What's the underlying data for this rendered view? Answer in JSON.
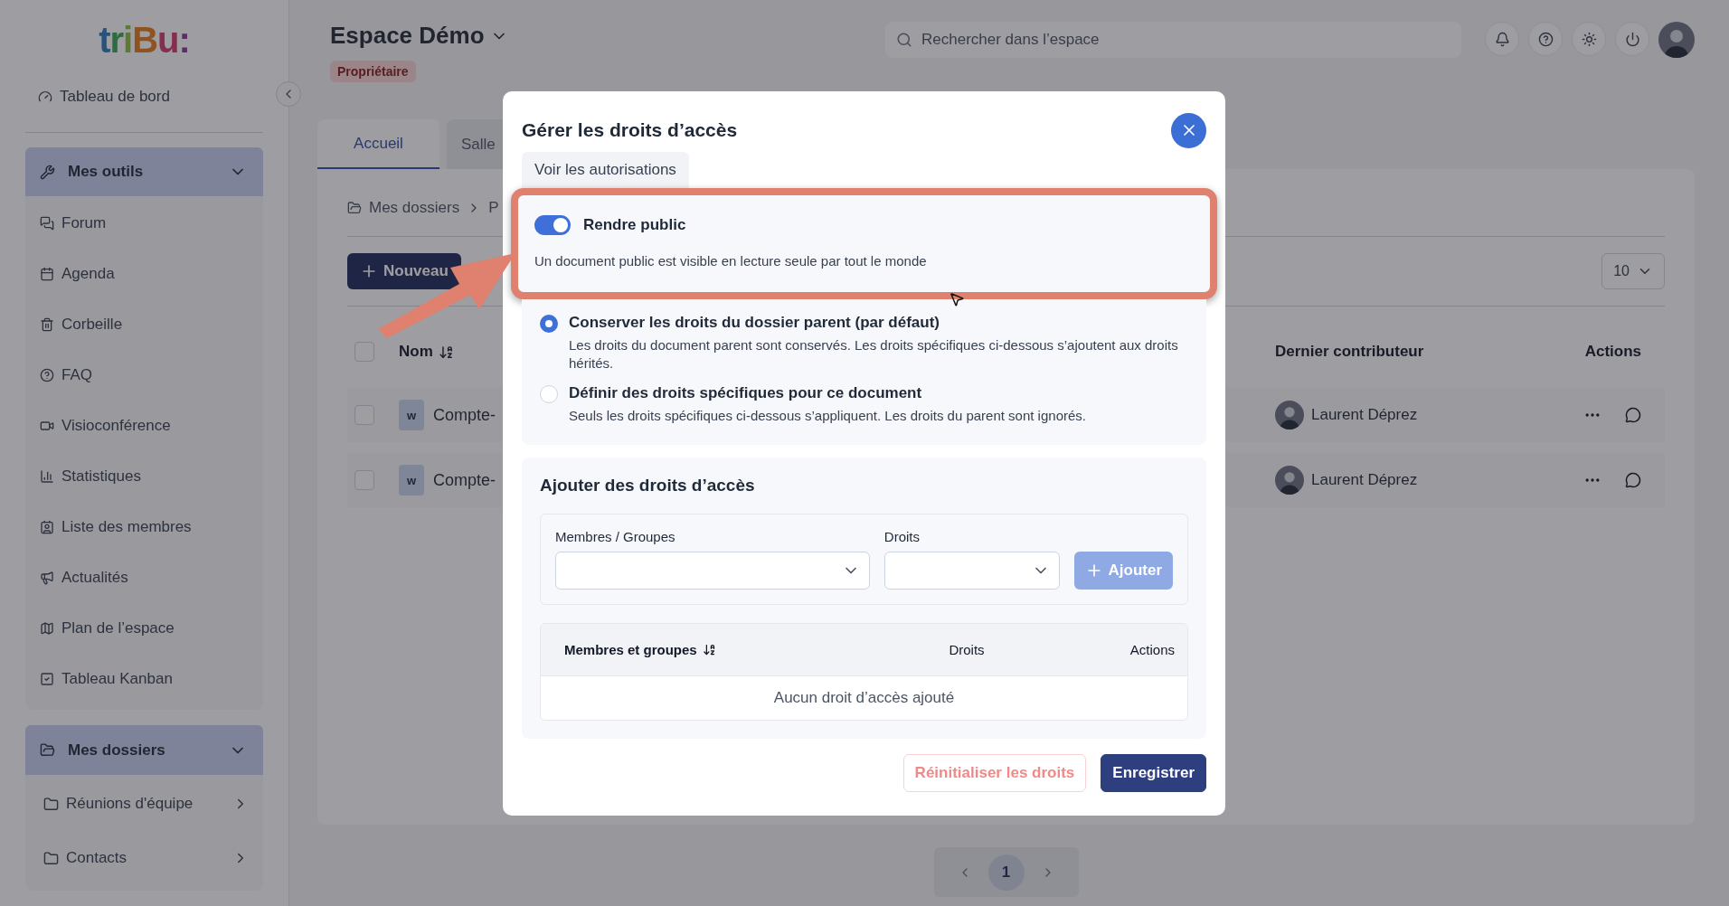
{
  "sidebar": {
    "logo": "triBu:",
    "dashboard": "Tableau de bord",
    "tools": {
      "title": "Mes outils",
      "expanded": true,
      "items": [
        {
          "label": "Forum"
        },
        {
          "label": "Agenda"
        },
        {
          "label": "Corbeille"
        },
        {
          "label": "FAQ"
        },
        {
          "label": "Visioconférence"
        },
        {
          "label": "Statistiques"
        },
        {
          "label": "Liste des membres"
        },
        {
          "label": "Actualités"
        },
        {
          "label": "Plan de l’espace"
        },
        {
          "label": "Tableau Kanban"
        }
      ]
    },
    "folders": {
      "title": "Mes dossiers",
      "expanded": true,
      "items": [
        {
          "label": "Réunions d'équipe",
          "expanded": false
        },
        {
          "label": "Contacts",
          "expanded": false
        }
      ]
    }
  },
  "header": {
    "space": "Espace Démo",
    "role": "Propriétaire",
    "search": {
      "placeholder": "Rechercher dans l’espace"
    }
  },
  "tabs": [
    {
      "label": "Accueil",
      "selected": true
    },
    {
      "label": "Salle",
      "selected": false
    }
  ],
  "content": {
    "breadcrumb": [
      "Mes dossiers",
      "P"
    ],
    "new_button": "Nouveau",
    "page_size": "10",
    "columns": [
      "Nom",
      "Dernier contributeur",
      "Actions"
    ],
    "all_checked": false,
    "rows": [
      {
        "name": "Compte-",
        "badge": "w",
        "contributor": "Laurent Déprez",
        "checked": false
      },
      {
        "name": "Compte-",
        "badge": "w",
        "contributor": "Laurent Déprez",
        "checked": false
      }
    ],
    "pagination": [
      {
        "label": "1",
        "selected": true
      }
    ]
  },
  "modal": {
    "title": "Gérer les droits d’accès",
    "tab": "Voir les autorisations",
    "public": {
      "label": "Rendre public",
      "on": true,
      "description": "Un document public est visible en lecture seule par tout le monde"
    },
    "inheritance": [
      {
        "title": "Conserver les droits du dossier parent (par défaut)",
        "description": "Les droits du document parent sont conservés. Les droits spécifiques ci-dessous s’ajoutent aux droits hérités.",
        "selected": true
      },
      {
        "title": "Définir des droits spécifiques pour ce document",
        "description": "Seuls les droits spécifiques ci-dessous s’appliquent. Les droits du parent sont ignorés.",
        "selected": false
      }
    ],
    "add": {
      "title": "Ajouter des droits d’accès",
      "member_label": "Membres / Groupes",
      "rights_label": "Droits",
      "add_button": {
        "label": "Ajouter",
        "disabled": true
      },
      "columns": [
        "Membres et groupes",
        "Droits",
        "Actions"
      ],
      "empty": "Aucun droit d’accès ajouté"
    },
    "buttons": [
      {
        "label": "Réinitialiser les droits",
        "kind": "outline"
      },
      {
        "label": "Enregistrer",
        "kind": "primary"
      }
    ]
  }
}
